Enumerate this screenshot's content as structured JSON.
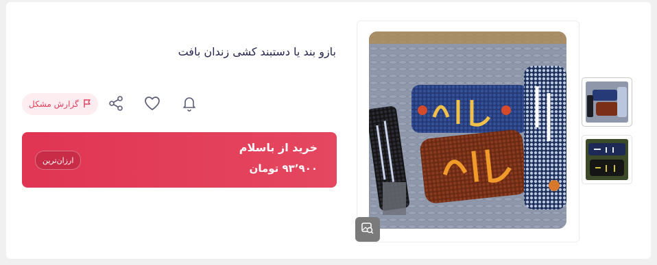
{
  "product": {
    "title": "بازو بند یا دستبند کشی زندان بافت"
  },
  "actions": {
    "report_label": "گزارش مشکل",
    "icons": [
      "flag-icon",
      "share-icon",
      "heart-icon",
      "bell-icon"
    ]
  },
  "buy": {
    "title": "خرید از باسلام",
    "price": "۹۳٬۹۰۰ تومان",
    "badge": "ارزان‌ترین"
  },
  "gallery": {
    "thumbnails": [
      "thumbnail-1",
      "thumbnail-2"
    ]
  },
  "colors": {
    "accent": "#e03553",
    "report_bg": "#fdecf0",
    "report_text": "#e0405e",
    "title_text": "#23254e"
  }
}
